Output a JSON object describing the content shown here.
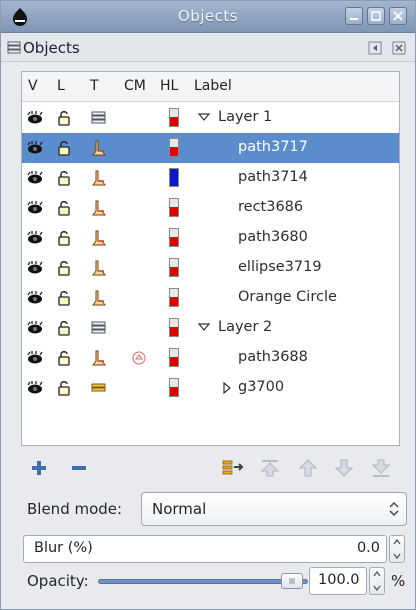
{
  "window": {
    "title": "Objects"
  },
  "dock": {
    "title": "Objects"
  },
  "columns": {
    "v": "V",
    "l": "L",
    "t": "T",
    "cm": "CM",
    "hl": "HL",
    "label": "Label"
  },
  "rows": [
    {
      "label": "Layer 1",
      "type": "layer",
      "hl_color": "#e00000",
      "expander": "expanded",
      "selected": false
    },
    {
      "label": "path3717",
      "type": "object",
      "hl_color": "#e00000",
      "selected": true
    },
    {
      "label": "path3714",
      "type": "object",
      "hl_color": "#0a18c8",
      "selected": false
    },
    {
      "label": "rect3686",
      "type": "object",
      "hl_color": "#e00000",
      "selected": false
    },
    {
      "label": "path3680",
      "type": "object",
      "hl_color": "#e00000",
      "selected": false
    },
    {
      "label": "ellipse3719",
      "type": "object",
      "hl_color": "#e00000",
      "selected": false
    },
    {
      "label": "Orange Circle",
      "type": "object",
      "hl_color": "#e00000",
      "selected": false
    },
    {
      "label": "Layer 2",
      "type": "layer",
      "hl_color": "#e00000",
      "expander": "expanded",
      "selected": false
    },
    {
      "label": "path3688",
      "type": "object",
      "hl_color": "#e00000",
      "clipmask": true,
      "selected": false
    },
    {
      "label": "g3700",
      "type": "group",
      "hl_color": "#e00000",
      "expander": "collapsed",
      "selected": false
    }
  ],
  "blend": {
    "label": "Blend mode:",
    "value": "Normal"
  },
  "blur": {
    "label": "Blur (%)",
    "value": "0.0"
  },
  "opacity": {
    "label": "Opacity:",
    "value": "100.0",
    "unit": "%",
    "level_percent": 100
  },
  "colors": {
    "selection": "#5b8ccb",
    "accent_blue": "#3d6fb3",
    "highlight_red": "#e00000",
    "highlight_blue": "#0a18c8"
  }
}
